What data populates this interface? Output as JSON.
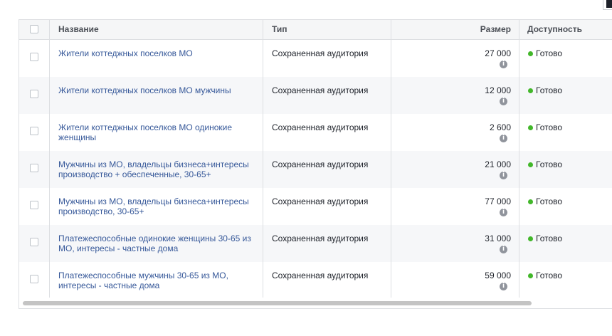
{
  "table": {
    "headers": {
      "name": "Название",
      "type": "Тип",
      "size": "Размер",
      "availability": "Доступность"
    },
    "rows": [
      {
        "name_lines": [
          "Жители коттеджных поселков МО"
        ],
        "type": "Сохраненная аудитория",
        "size": "27 000",
        "status": "Готово"
      },
      {
        "name_lines": [
          "Жители коттеджных поселков МО мужчины"
        ],
        "type": "Сохраненная аудитория",
        "size": "12 000",
        "status": "Готово"
      },
      {
        "name_lines": [
          "Жители коттеджных поселков МО одинокие",
          "женщины"
        ],
        "type": "Сохраненная аудитория",
        "size": "2 600",
        "status": "Готово"
      },
      {
        "name_lines": [
          "Мужчины из МО, владельцы бизнеса+интересы",
          "производство + обеспеченные, 30-65+"
        ],
        "type": "Сохраненная аудитория",
        "size": "21 000",
        "status": "Готово"
      },
      {
        "name_lines": [
          "Мужчины из МО, владельцы бизнеса+интересы",
          "производство, 30-65+"
        ],
        "type": "Сохраненная аудитория",
        "size": "77 000",
        "status": "Готово"
      },
      {
        "name_lines": [
          "Платежеспособные одинокие женщины 30-65 из",
          "МО, интересы - частные дома"
        ],
        "type": "Сохраненная аудитория",
        "size": "31 000",
        "status": "Готово"
      },
      {
        "name_lines": [
          "Платежеспособные мужчины 30-65 из МО,",
          "интересы - частные дома"
        ],
        "type": "Сохраненная аудитория",
        "size": "59 000",
        "status": "Готово"
      }
    ]
  },
  "icons": {
    "info": "info-icon",
    "status": "status-dot"
  },
  "colors": {
    "link": "#365899",
    "status_ready": "#42b72a",
    "alt_row": "#f6f7f9",
    "header_bg": "#f5f6f7"
  }
}
